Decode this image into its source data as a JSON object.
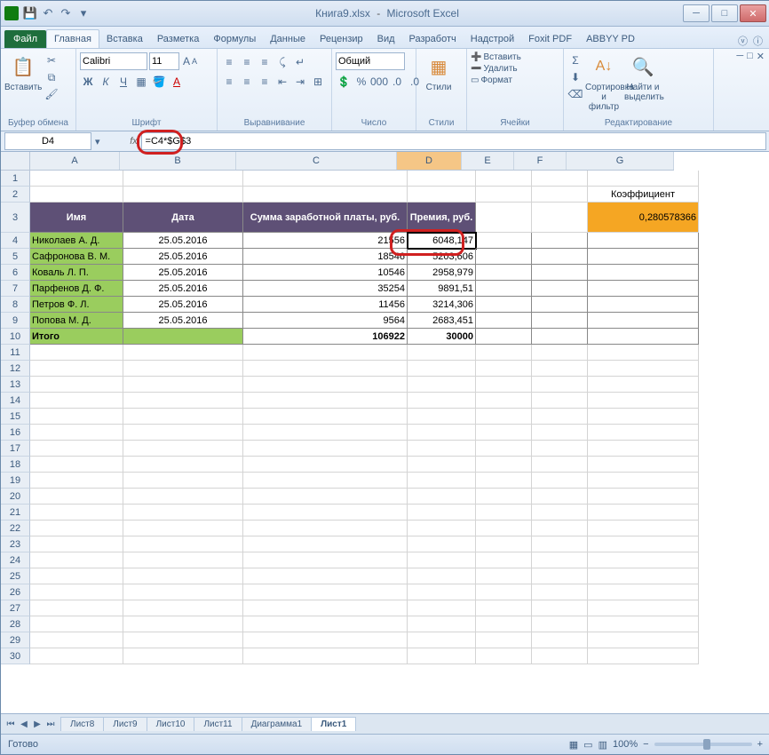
{
  "title": {
    "file": "Книга9.xlsx",
    "app": "Microsoft Excel"
  },
  "tabs": {
    "file": "Файл",
    "items": [
      "Главная",
      "Вставка",
      "Разметка",
      "Формулы",
      "Данные",
      "Рецензир",
      "Вид",
      "Разработч",
      "Надстрой",
      "Foxit PDF",
      "ABBYY PD"
    ],
    "active": 0
  },
  "ribbon": {
    "clipboard": {
      "paste": "Вставить",
      "label": "Буфер обмена"
    },
    "font": {
      "name": "Calibri",
      "size": "11",
      "label": "Шрифт"
    },
    "align": {
      "label": "Выравнивание"
    },
    "number": {
      "format": "Общий",
      "label": "Число"
    },
    "styles": {
      "label": "Стили",
      "btn": "Стили"
    },
    "cells": {
      "insert": "Вставить",
      "delete": "Удалить",
      "format": "Формат",
      "label": "Ячейки"
    },
    "editing": {
      "sort": "Сортировка и фильтр",
      "find": "Найти и выделить",
      "label": "Редактирование"
    }
  },
  "namebox": "D4",
  "formula": "=C4*$G$3",
  "cols": {
    "A": 100,
    "B": 130,
    "C": 180,
    "D": 72,
    "E": 58,
    "F": 58,
    "G": 120
  },
  "headers": {
    "A": "Имя",
    "B": "Дата",
    "C": "Сумма заработной платы, руб.",
    "D": "Премия, руб.",
    "G2": "Коэффициент"
  },
  "coef": "0,280578366",
  "rows": [
    {
      "n": "Николаев А. Д.",
      "d": "25.05.2016",
      "s": "21556",
      "p": "6048,147"
    },
    {
      "n": "Сафронова В. М.",
      "d": "25.05.2016",
      "s": "18546",
      "p": "5203,606"
    },
    {
      "n": "Коваль Л. П.",
      "d": "25.05.2016",
      "s": "10546",
      "p": "2958,979"
    },
    {
      "n": "Парфенов Д. Ф.",
      "d": "25.05.2016",
      "s": "35254",
      "p": "9891,51"
    },
    {
      "n": "Петров Ф. Л.",
      "d": "25.05.2016",
      "s": "11456",
      "p": "3214,306"
    },
    {
      "n": "Попова М. Д.",
      "d": "25.05.2016",
      "s": "9564",
      "p": "2683,451"
    }
  ],
  "total": {
    "label": "Итого",
    "s": "106922",
    "p": "30000"
  },
  "sheets": [
    "Лист8",
    "Лист9",
    "Лист10",
    "Лист11",
    "Диаграмма1",
    "Лист1"
  ],
  "active_sheet": 5,
  "status": {
    "ready": "Готово",
    "zoom": "100%"
  }
}
